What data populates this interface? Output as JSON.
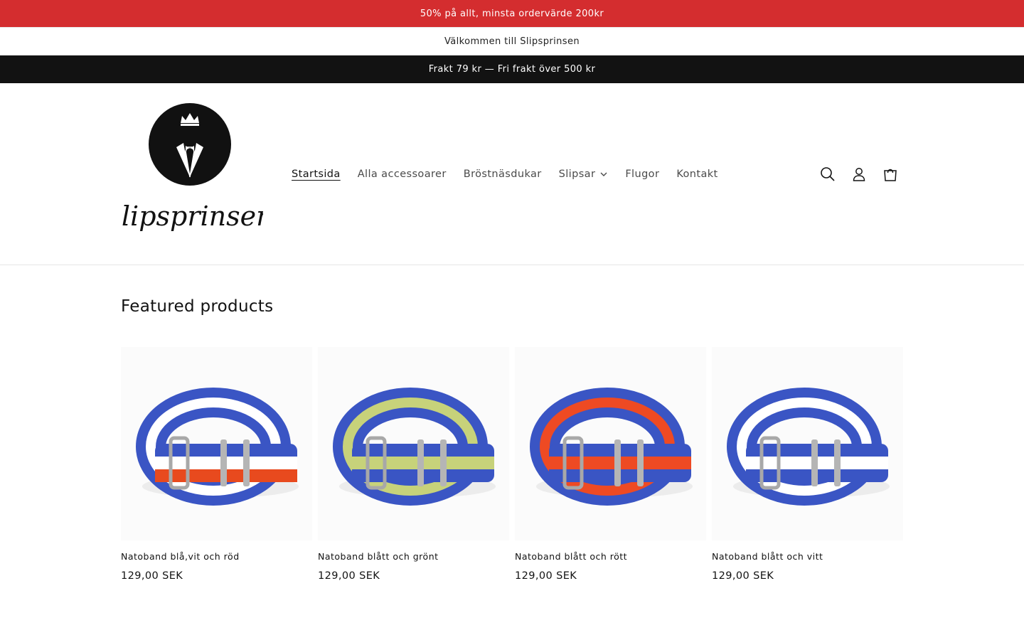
{
  "announcements": [
    "50% på allt, minsta ordervärde 200kr",
    "Välkommen till Slipsprinsen",
    "Frakt 79 kr — Fri frakt över 500 kr"
  ],
  "header": {
    "logo_text": "slipsprinsen",
    "nav": [
      {
        "label": "Startsida",
        "active": true
      },
      {
        "label": "Alla accessoarer",
        "active": false
      },
      {
        "label": "Bröstnäsdukar",
        "active": false
      },
      {
        "label": "Slipsar",
        "active": false,
        "dropdown": true
      },
      {
        "label": "Flugor",
        "active": false
      },
      {
        "label": "Kontakt",
        "active": false
      }
    ],
    "icons": [
      "search-icon",
      "account-icon",
      "cart-icon"
    ]
  },
  "featured": {
    "title": "Featured products",
    "products": [
      {
        "title": "Natoband blå,vit och röd",
        "price": "129,00 SEK",
        "stripes": [
          "#3a55c4",
          "#ffffff",
          "#e84a1e"
        ]
      },
      {
        "title": "Natoband blått och grönt",
        "price": "129,00 SEK",
        "stripes": [
          "#3a55c4",
          "#c7d27a",
          "#3a55c4"
        ]
      },
      {
        "title": "Natoband blått och rött",
        "price": "129,00 SEK",
        "stripes": [
          "#3a55c4",
          "#ee4a23",
          "#3a55c4"
        ]
      },
      {
        "title": "Natoband blått och vitt",
        "price": "129,00 SEK",
        "stripes": [
          "#3a55c4",
          "#ffffff",
          "#3a55c4"
        ]
      }
    ]
  },
  "colors": {
    "promo_bar": "#d42d2f",
    "shipping_bar": "#121212",
    "text": "#121212"
  }
}
